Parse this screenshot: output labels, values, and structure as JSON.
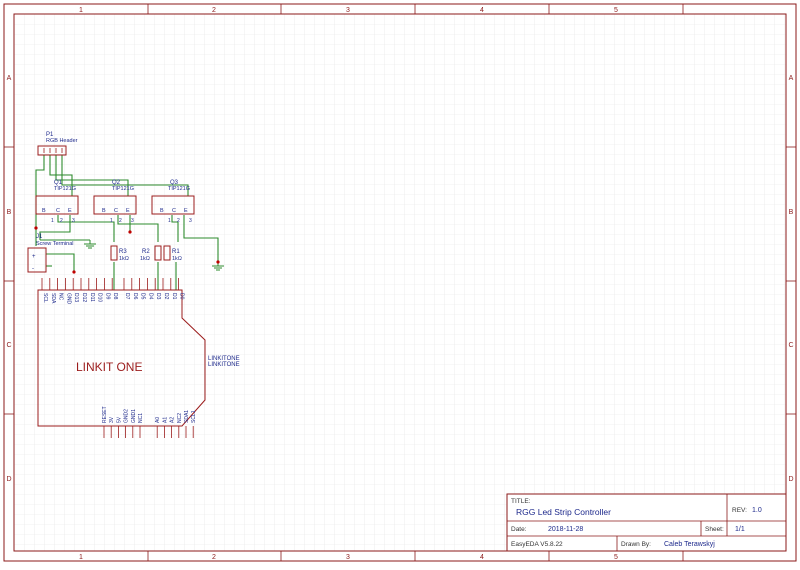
{
  "frame": {
    "columns": [
      "1",
      "2",
      "3",
      "4",
      "5"
    ],
    "rows": [
      "A",
      "B",
      "C",
      "D"
    ]
  },
  "components": {
    "p1": {
      "ref": "P1",
      "name": "RGB Header"
    },
    "q1": {
      "ref": "Q1",
      "name": "TIP121G",
      "pins": [
        "B",
        "C",
        "E"
      ],
      "nums": [
        "1",
        "2",
        "3"
      ]
    },
    "q2": {
      "ref": "Q2",
      "name": "TIP121G",
      "pins": [
        "B",
        "C",
        "E"
      ],
      "nums": [
        "1",
        "2",
        "3"
      ]
    },
    "q3": {
      "ref": "Q3",
      "name": "TIP121G",
      "pins": [
        "B",
        "C",
        "E"
      ],
      "nums": [
        "1",
        "2",
        "3"
      ]
    },
    "j1": {
      "ref": "J1",
      "name": "Screw Terminal",
      "plus": "+",
      "minus": "-"
    },
    "r1": {
      "ref": "R1",
      "value": "1kΩ"
    },
    "r2": {
      "ref": "R2",
      "value": "1kΩ"
    },
    "r3": {
      "ref": "R3",
      "value": "1kΩ"
    },
    "u1": {
      "label": "LINKIT ONE",
      "name": "LINKITONE",
      "name2": "LINKITONE",
      "top_pins": [
        "SCL",
        "SDA",
        "NC",
        "GND",
        "D13",
        "D12",
        "D11",
        "D10",
        "D9",
        "D8",
        "D7",
        "D6",
        "D5",
        "D4",
        "D3",
        "D2",
        "D1",
        "D0"
      ],
      "bottom_pins": [
        "RESET",
        "3V",
        "5V",
        "GND2",
        "GND1",
        "NC1",
        "A0",
        "A1",
        "A2",
        "NC2",
        "SDA1",
        "SCL1"
      ]
    }
  },
  "title_block": {
    "title_label": "TITLE:",
    "title": "RGG Led Strip Controller",
    "rev_label": "REV:",
    "rev": "1.0",
    "date_label": "Date:",
    "date": "2018-11-28",
    "sheet_label": "Sheet:",
    "sheet": "1/1",
    "tool": "EasyEDA V5.8.22",
    "drawn_label": "Drawn By:",
    "drawn_by": "Caleb Terawskyj"
  },
  "colors": {
    "frame": "#8b1a1a",
    "grid": "#e3e3e3",
    "wire": "#2e8b2e",
    "part": "#9b1c1c",
    "text": "#1e2a8c",
    "pin_dot": "#c00000"
  }
}
